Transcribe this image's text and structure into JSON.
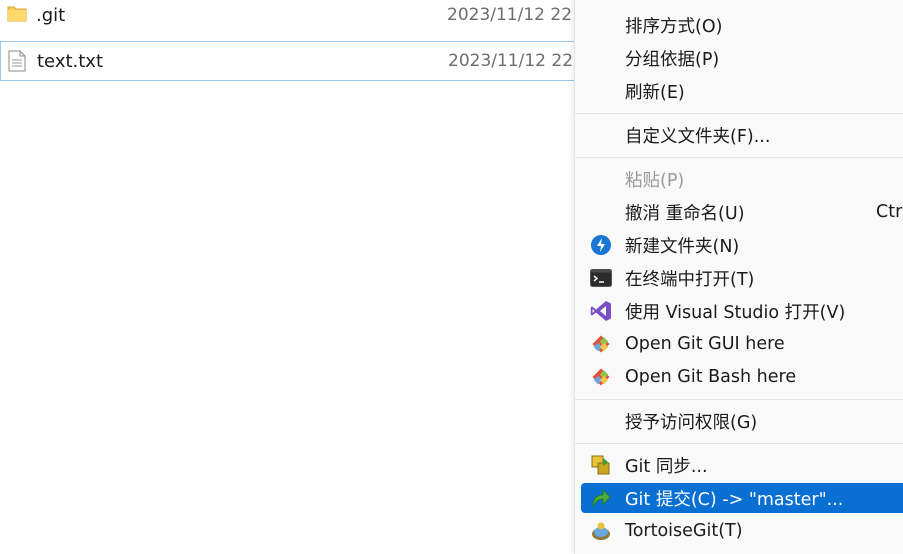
{
  "files": [
    {
      "name": ".git",
      "date": "2023/11/12 22",
      "icon": "folder-icon"
    },
    {
      "name": "text.txt",
      "date": "2023/11/12 22",
      "icon": "text-file-icon"
    }
  ],
  "menu": {
    "items": [
      {
        "label": "排序方式(O)"
      },
      {
        "label": "分组依据(P)"
      },
      {
        "label": "刷新(E)"
      },
      {
        "label": "自定义文件夹(F)..."
      },
      {
        "label": "粘贴(P)"
      },
      {
        "label": "撤消 重命名(U)",
        "shortcut": "Ctrl"
      },
      {
        "label": "新建文件夹(N)",
        "icon": "new-folder-icon"
      },
      {
        "label": "在终端中打开(T)",
        "icon": "terminal-icon"
      },
      {
        "label": "使用 Visual Studio 打开(V)",
        "icon": "visual-studio-icon"
      },
      {
        "label": "Open Git GUI here",
        "icon": "git-gui-icon"
      },
      {
        "label": "Open Git Bash here",
        "icon": "git-bash-icon"
      },
      {
        "label": "授予访问权限(G)"
      },
      {
        "label": "Git 同步...",
        "icon": "git-sync-icon"
      },
      {
        "label": "Git 提交(C) -> \"master\"...",
        "icon": "git-commit-icon"
      },
      {
        "label": "TortoiseGit(T)",
        "icon": "tortoisegit-icon"
      }
    ]
  },
  "colors": {
    "accent": "#0a6fd3",
    "selection_border": "#99c9ef",
    "menu_bg": "#f9f9f9"
  }
}
